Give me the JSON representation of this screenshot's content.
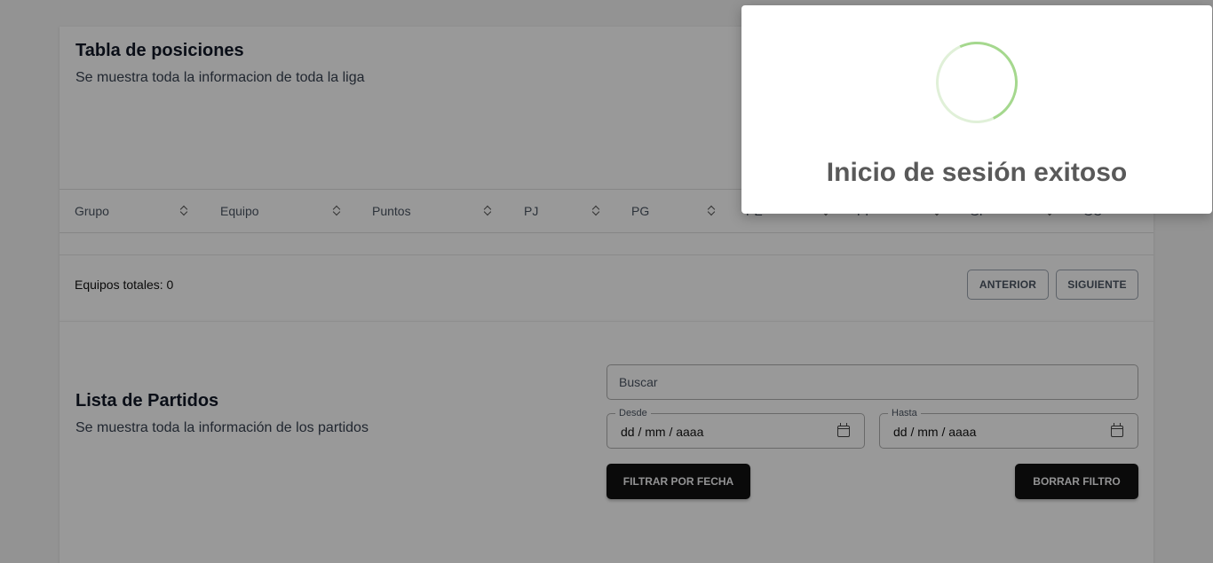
{
  "standings": {
    "title": "Tabla de posiciones",
    "subtitle": "Se muestra toda la informacion de toda la liga",
    "columns": [
      "Grupo",
      "Equipo",
      "Puntos",
      "PJ",
      "PG",
      "PE",
      "PP",
      "GF",
      "GC"
    ],
    "total_label": "Equipos totales: 0",
    "prev_label": "ANTERIOR",
    "next_label": "SIGUIENTE"
  },
  "matches": {
    "title": "Lista de Partidos",
    "subtitle": "Se muestra toda la información de los partidos",
    "search_placeholder": "Buscar",
    "from_label": "Desde",
    "from_value": "dd / mm / aaaa",
    "to_label": "Hasta",
    "to_value": "dd / mm / aaaa",
    "filter_button": "FILTRAR POR FECHA",
    "clear_button": "BORRAR FILTRO"
  },
  "toast": {
    "message": "Inicio de sesión exitoso",
    "icon": "loading-spinner-icon"
  },
  "colors": {
    "spinner": "#a5d88e",
    "overlay": "rgba(0,0,0,0.4)",
    "dark_button": "#111111"
  }
}
